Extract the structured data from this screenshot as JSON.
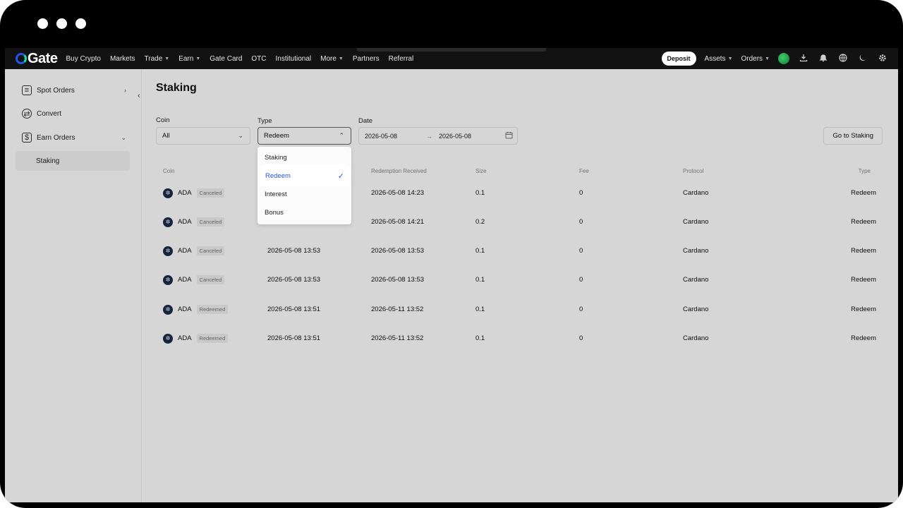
{
  "window": {
    "controls": [
      "close",
      "minimize",
      "maximize"
    ]
  },
  "topnav": {
    "logo_text": "Gate",
    "items": [
      {
        "label": "Buy Crypto",
        "caret": false
      },
      {
        "label": "Markets",
        "caret": false
      },
      {
        "label": "Trade",
        "caret": true
      },
      {
        "label": "Earn",
        "caret": true
      },
      {
        "label": "Gate Card",
        "caret": false
      },
      {
        "label": "OTC",
        "caret": false
      },
      {
        "label": "Institutional",
        "caret": false
      },
      {
        "label": "More",
        "caret": true
      },
      {
        "label": "Partners",
        "caret": false
      },
      {
        "label": "Referral",
        "caret": false
      }
    ],
    "deposit_label": "Deposit",
    "assets_label": "Assets",
    "orders_label": "Orders",
    "icons": [
      "download-icon",
      "bell-icon",
      "globe-icon",
      "moon-icon",
      "gear-icon"
    ]
  },
  "sidebar": {
    "items": [
      {
        "label": "Spot Orders",
        "icon": "spot-orders-icon",
        "chevron": "right"
      },
      {
        "label": "Convert",
        "icon": "convert-icon",
        "chevron": ""
      },
      {
        "label": "Earn Orders",
        "icon": "earn-orders-icon",
        "chevron": "down"
      }
    ],
    "sub_item": "Staking"
  },
  "page": {
    "title": "Staking",
    "go_button": "Go to Staking"
  },
  "filters": {
    "coin": {
      "label": "Coin",
      "value": "All"
    },
    "type": {
      "label": "Type",
      "value": "Redeem"
    },
    "date": {
      "label": "Date",
      "start": "2026-05-08",
      "end": "2026-05-08"
    }
  },
  "dropdown": {
    "options": [
      "Staking",
      "Redeem",
      "Interest",
      "Bonus"
    ],
    "selected": "Redeem"
  },
  "table": {
    "headers": [
      "Coin",
      "Redemption Received",
      "Size",
      "Fee",
      "Protocol",
      "Type"
    ],
    "rows": [
      {
        "coin": "ADA",
        "status": "Canceled",
        "time": "",
        "received": "2026-05-08 14:23",
        "size": "0.1",
        "fee": "0",
        "protocol": "Cardano",
        "type": "Redeem"
      },
      {
        "coin": "ADA",
        "status": "Canceled",
        "time": "",
        "received": "2026-05-08 14:21",
        "size": "0.2",
        "fee": "0",
        "protocol": "Cardano",
        "type": "Redeem"
      },
      {
        "coin": "ADA",
        "status": "Canceled",
        "time": "2026-05-08 13:53",
        "received": "2026-05-08 13:53",
        "size": "0.1",
        "fee": "0",
        "protocol": "Cardano",
        "type": "Redeem"
      },
      {
        "coin": "ADA",
        "status": "Canceled",
        "time": "2026-05-08 13:53",
        "received": "2026-05-08 13:53",
        "size": "0.1",
        "fee": "0",
        "protocol": "Cardano",
        "type": "Redeem"
      },
      {
        "coin": "ADA",
        "status": "Redeemed",
        "time": "2026-05-08 13:51",
        "received": "2026-05-11 13:52",
        "size": "0.1",
        "fee": "0",
        "protocol": "Cardano",
        "type": "Redeem"
      },
      {
        "coin": "ADA",
        "status": "Redeemed",
        "time": "2026-05-08 13:51",
        "received": "2026-05-11 13:52",
        "size": "0.1",
        "fee": "0",
        "protocol": "Cardano",
        "type": "Redeem"
      }
    ]
  },
  "colors": {
    "accent": "#2354e6",
    "brand_green": "#17e0a0",
    "nav_bg": "#121212"
  }
}
